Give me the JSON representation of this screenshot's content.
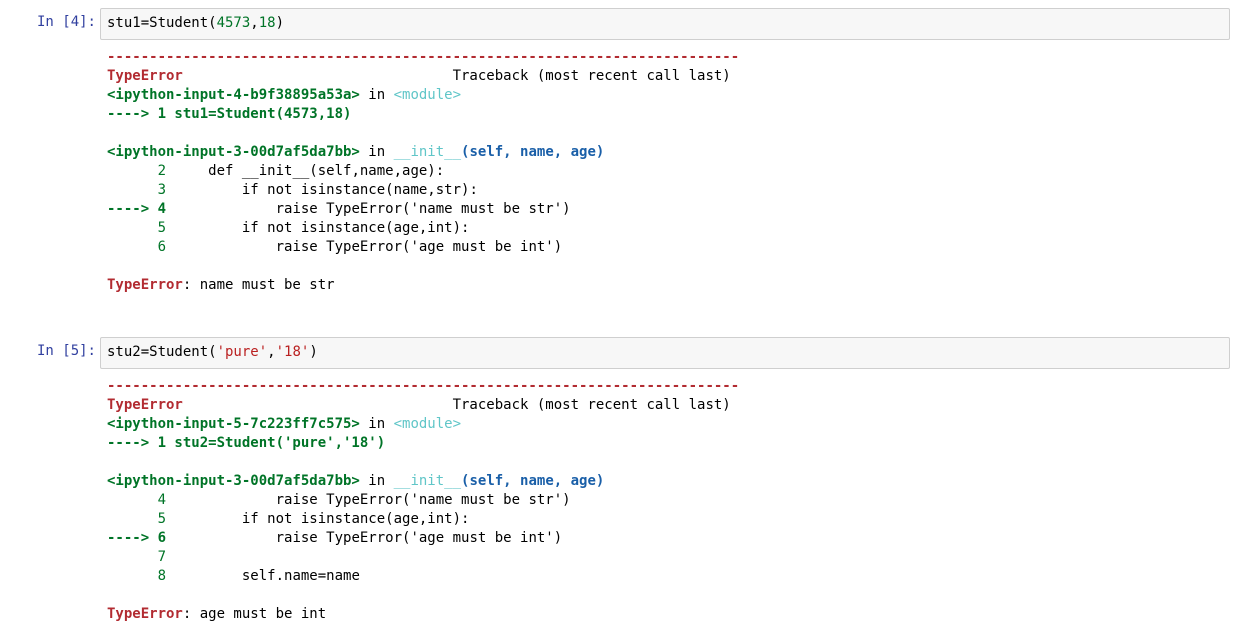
{
  "cells": [
    {
      "prompt": "In  [4]:",
      "code_pre": "stu1=Student(",
      "code_arg1": "4573",
      "code_sep": ",",
      "code_arg2": "18",
      "code_post": ")",
      "dashes": "---------------------------------------------------------------------------",
      "error_name": "TypeError",
      "traceback_label": "                                Traceback (most recent call last)",
      "frame1_file": "<ipython-input-4-b9f38895a53a>",
      "frame1_in": " in ",
      "frame1_module": "<module>",
      "frame1_arrow": "----> 1 stu1=Student(4573,18)",
      "frame2_file": "<ipython-input-3-00d7af5da7bb>",
      "frame2_in": " in ",
      "frame2_func": "__init__",
      "frame2_sig": "(self, name, age)",
      "frame2_lines": [
        {
          "num": "      2 ",
          "code": "    def __init__(self,name,age):"
        },
        {
          "num": "      3 ",
          "code": "        if not isinstance(name,str):"
        },
        {
          "num": "----> 4 ",
          "code": "            raise TypeError('name must be str')"
        },
        {
          "num": "      5 ",
          "code": "        if not isinstance(age,int):"
        },
        {
          "num": "      6 ",
          "code": "            raise TypeError('age must be int')"
        }
      ],
      "final_error_name": "TypeError",
      "final_error_msg": ": name must be str"
    },
    {
      "prompt": "In  [5]:",
      "code_pre": "stu2=Student(",
      "code_arg1": "'pure'",
      "code_sep": ",",
      "code_arg2": "'18'",
      "code_post": ")",
      "dashes": "---------------------------------------------------------------------------",
      "error_name": "TypeError",
      "traceback_label": "                                Traceback (most recent call last)",
      "frame1_file": "<ipython-input-5-7c223ff7c575>",
      "frame1_in": " in ",
      "frame1_module": "<module>",
      "frame1_arrow": "----> 1 stu2=Student('pure','18')",
      "frame2_file": "<ipython-input-3-00d7af5da7bb>",
      "frame2_in": " in ",
      "frame2_func": "__init__",
      "frame2_sig": "(self, name, age)",
      "frame2_lines": [
        {
          "num": "      4 ",
          "code": "            raise TypeError('name must be str')"
        },
        {
          "num": "      5 ",
          "code": "        if not isinstance(age,int):"
        },
        {
          "num": "----> 6 ",
          "code": "            raise TypeError('age must be int')"
        },
        {
          "num": "      7 ",
          "code": ""
        },
        {
          "num": "      8 ",
          "code": "        self.name=name"
        }
      ],
      "final_error_name": "TypeError",
      "final_error_msg": ": age must be int"
    }
  ]
}
